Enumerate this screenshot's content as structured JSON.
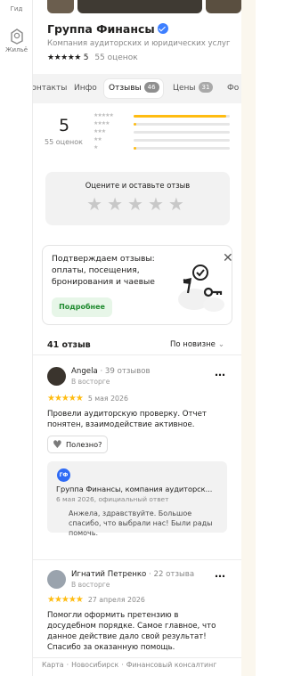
{
  "rail": {
    "items": [
      {
        "label": "Гид",
        "icon": "guide-icon"
      },
      {
        "label": "Жильё",
        "icon": "housing-icon"
      }
    ]
  },
  "org": {
    "title": "Группа Финансы",
    "subtitle": "Компания аудиторских и юридических услуг",
    "rating_stars": "★★★★★",
    "rating_value": "5",
    "rating_count": "55 оценок"
  },
  "tabs": [
    {
      "label": "Контакты",
      "badge": ""
    },
    {
      "label": "Инфо",
      "badge": ""
    },
    {
      "label": "Отзывы",
      "badge": "46",
      "active": true
    },
    {
      "label": "Цены",
      "badge": "31"
    },
    {
      "label": "Фо",
      "badge": ""
    }
  ],
  "summary": {
    "score": "5",
    "count_label": "55 оценок",
    "histogram": [
      {
        "stars": "★★★★★",
        "share": 0.96
      },
      {
        "stars": "★★★★",
        "share": 0.02
      },
      {
        "stars": "★★★",
        "share": 0.0
      },
      {
        "stars": "★★",
        "share": 0.0
      },
      {
        "stars": "★",
        "share": 0.02
      }
    ]
  },
  "rate_card": {
    "title": "Оцените и оставьте отзыв",
    "stars": "★★★★★"
  },
  "promo": {
    "text": "Подтверждаем отзывы: оплаты, посещения, бронирования и чаевые",
    "button": "Подробнее",
    "close": "✕"
  },
  "reviews_header": {
    "count": "41 отзыв",
    "sort": "По новизне",
    "sort_chevron": "⌄"
  },
  "reviews": [
    {
      "name": "Angela",
      "reviews_count": " · 39 отзывов",
      "level": "В восторге",
      "stars": "★★★★★",
      "date": "5 мая 2026",
      "text": "Провели аудиторскую проверку. Отчет понятен, взаимодействие активное.",
      "useful": "Полезно?",
      "reply": {
        "logo": "ГФ",
        "org": "Группа Финансы, компания аудиторск...",
        "meta": "6 мая 2026, официальный ответ",
        "text": "Анжела, здравствуйте. Большое спасибо, что выбрали нас! Были рады помочь."
      }
    },
    {
      "name": "Игнатий Петренко",
      "reviews_count": " · 22 отзыва",
      "level": "В восторге",
      "stars": "★★★★★",
      "date": "27 апреля 2026",
      "text": "Помогли оформить претензию в досудебном порядке. Самое главное, что данное действие дало свой результат! Спасибо за оказанную помощь."
    }
  ],
  "breadcrumbs": [
    "Карта",
    "Новосибирск",
    "Финансовый консалтинг"
  ],
  "colors": {
    "star": "#ffbc11",
    "verified": "#3d7fff",
    "promo_button_bg": "#e7f6e8",
    "promo_button_text": "#1e8a2e"
  }
}
